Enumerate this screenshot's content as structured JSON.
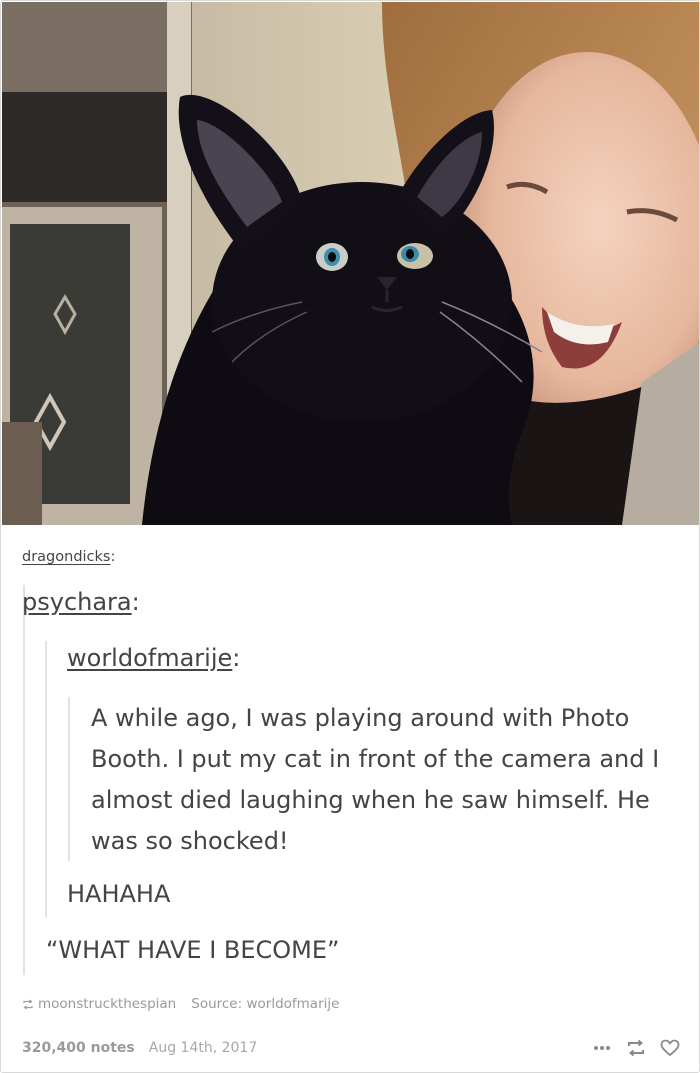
{
  "post": {
    "source_user": "dragondicks",
    "quotes": [
      {
        "user": "psychara"
      },
      {
        "user": "worldofmarije",
        "text": "A while ago, I was playing around with Photo Booth. I put my cat in front of the camera and I almost died laughing when he saw himself. He was so shocked!"
      }
    ],
    "reply_1": "HAHAHA",
    "reply_2": "“WHAT HAVE I BECOME”",
    "reblogged_from": "moonstruckthespian",
    "source_label": "Source:",
    "source_name": "worldofmarije",
    "notes": "320,400 notes",
    "date": "Aug 14th, 2017"
  },
  "icons": {
    "reblog_small": "reblog-icon",
    "more": "more-dots-icon",
    "reblog": "reblog-icon",
    "like": "heart-icon"
  },
  "colors": {
    "text": "#444444",
    "meta": "#9a9a9a",
    "quote_border": "#e2e2e2"
  }
}
